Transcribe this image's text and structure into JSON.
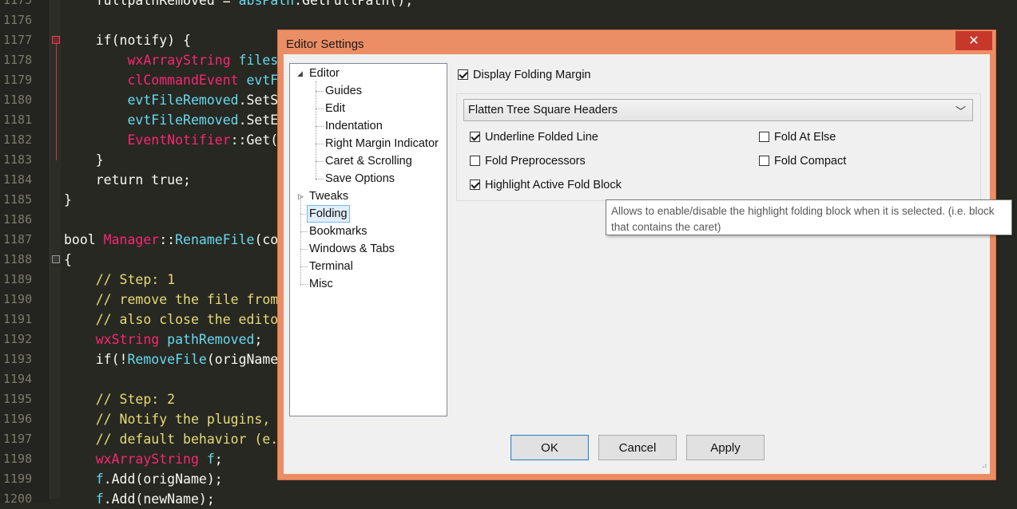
{
  "editor": {
    "lines": [
      {
        "num": "1175",
        "html": "    <span class='kw'>fullpathRemoved</span> = <span class='id'>absPath</span>.GetFullPath();"
      },
      {
        "num": "1176",
        "html": ""
      },
      {
        "num": "1177",
        "html": "    if(notify) {"
      },
      {
        "num": "1178",
        "html": "        <span class='ty'>wxArrayString</span> <span class='id'>files</span>"
      },
      {
        "num": "1179",
        "html": "        <span class='ty'>clCommandEvent</span> <span class='id'>evtF</span>"
      },
      {
        "num": "1180",
        "html": "        <span class='id'>evtFileRemoved</span>.SetS"
      },
      {
        "num": "1181",
        "html": "        <span class='id'>evtFileRemoved</span>.SetE"
      },
      {
        "num": "1182",
        "html": "        <span class='ty'>EventNotifier</span>::Get("
      },
      {
        "num": "1183",
        "html": "    }"
      },
      {
        "num": "1184",
        "html": "    return true;"
      },
      {
        "num": "1185",
        "html": "}"
      },
      {
        "num": "1186",
        "html": ""
      },
      {
        "num": "1187",
        "html": "bool <span class='ty'>Manager</span>::<span class='id'>RenameFile</span>(co"
      },
      {
        "num": "1188",
        "html": "{"
      },
      {
        "num": "1189",
        "html": "    <span class='cm'>// Step: 1</span>"
      },
      {
        "num": "1190",
        "html": "    <span class='cm'>// remove the file from</span>"
      },
      {
        "num": "1191",
        "html": "    <span class='cm'>// also close the edito</span>"
      },
      {
        "num": "1192",
        "html": "    <span class='ty'>wxString</span> <span class='id'>pathRemoved</span>;"
      },
      {
        "num": "1193",
        "html": "    if(!<span class='id'>RemoveFile</span>(origName"
      },
      {
        "num": "1194",
        "html": ""
      },
      {
        "num": "1195",
        "html": "    <span class='cm'>// Step: 2</span>"
      },
      {
        "num": "1196",
        "html": "    <span class='cm'>// Notify the plugins,</span>"
      },
      {
        "num": "1197",
        "html": "    <span class='cm'>// default behavior (e.</span>"
      },
      {
        "num": "1198",
        "html": "    <span class='ty'>wxArrayString</span> <span class='id'>f</span>;"
      },
      {
        "num": "1199",
        "html": "    <span class='id'>f</span>.Add(origName);"
      },
      {
        "num": "1200",
        "html": "    <span class='id'>f</span>.Add(newName);"
      }
    ]
  },
  "dialog": {
    "title": "Editor Settings",
    "close_glyph": "✕",
    "tree": {
      "editor": "Editor",
      "children": [
        "Guides",
        "Edit",
        "Indentation",
        "Right Margin Indicator",
        "Caret & Scrolling",
        "Save Options"
      ],
      "tweaks": "Tweaks",
      "folding": "Folding",
      "bookmarks": "Bookmarks",
      "windows_tabs": "Windows & Tabs",
      "terminal": "Terminal",
      "misc": "Misc"
    },
    "display_folding_margin": {
      "label": "Display Folding Margin",
      "checked": true
    },
    "style_select": {
      "value": "Flatten Tree Square Headers"
    },
    "options": {
      "underline_folded_line": {
        "label": "Underline Folded Line",
        "checked": true
      },
      "fold_at_else": {
        "label": "Fold At Else",
        "checked": false
      },
      "fold_preprocessors": {
        "label": "Fold Preprocessors",
        "checked": false
      },
      "fold_compact": {
        "label": "Fold Compact",
        "checked": false
      },
      "highlight_active_fold_block": {
        "label": "Highlight Active Fold Block",
        "checked": true
      }
    },
    "tooltip": "Allows to enable/disable the highlight folding block when it is selected. (i.e. block that contains the caret)",
    "buttons": {
      "ok": "OK",
      "cancel": "Cancel",
      "apply": "Apply"
    }
  }
}
